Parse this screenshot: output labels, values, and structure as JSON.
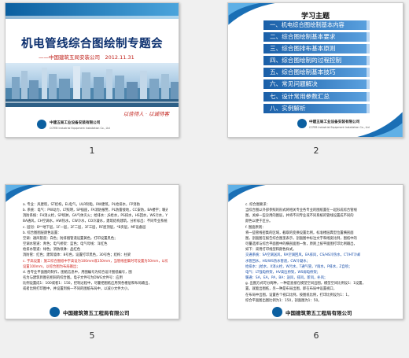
{
  "slides": [
    {
      "number": "1",
      "title": "机电管线综合图绘制专题会",
      "subtitle": "——中国建筑五局安装公司　2012.11.31",
      "slogan": "以信待人 · 以诚待客",
      "company_cn": "中建五局工业设备安装有限公司",
      "company_en": "CCFEB Industrial Equipment Installation Co., Ltd"
    },
    {
      "number": "2",
      "heading": "学习主题",
      "items": [
        "一、机电综合图绘制基本内容",
        "二、综合图绘制基本要求",
        "三、综合图排布基本原则",
        "四、综合图绘制的过程控制",
        "五、综合图绘制基本技巧",
        "六、常见问题解决",
        "七、设计常用参数汇总",
        "八、实例解析"
      ],
      "company_cn": "中建五局工业设备安装有限公司",
      "company_en": "CCFEB Industrial Equipment Installation Co., Ltd"
    },
    {
      "number": "5",
      "lines": [
        "a. 专业：风建筑，ST结构，EL电气，ULR制电，RW建筑，PL给排水，FP消防",
        "b. 系统：电气：PW动力，LT照明，SP插座，FA消防报警，PL防雷接地，CC安防，BA楼宇；暖通：SA送风，RA回风，EA排风，",
        "   消防系统：FH消火栓，SP喷淋，GA气体灭火；给排水：JS给水，PS排水，HS回水，WS污水，YS雨水；",
        "   BA通风，CH空调水，HW热水，CW冷水，CO冷凝水，建筑结构建筑，分析标出：不同专业系统，",
        "c. 层别：B**地下层，1F一层，2F二层，3F三层，RF屋顶层，*B夹层，MF设备层",
        "b. 综合图图层颜色设置：",
        "   空调：通风管道：白色；防排烟管道设置黄色，打印设置黑色；",
        "   空调水管道：青色；电气桥架：蓝色；电气母线：洋红色",
        "   给排水管道：绿色；消防喷淋：品红色",
        "   消防管：红色；建筑墙体：8号色，设置打印黑色，30号色；结构：柱梁",
        "c. 字高设置：施工综合图纸中字高设为100mm或150mm，当管线密集时可设置为50mm，以综合图为布局输出",
        "   设置100mm，以综合图为布局输出；",
        "d. 各专业平面图的制作，图纸信息中，用图编号为综合设计图纸编号，图",
        "   名为与建筑目图名相同的综合图。电子文件号为DWG文件号：应用",
        "   比例设置成1：100或者1：150，控制过程中，尽量把图纸应用到各楼层和布局输出，",
        "   或者比例打印图中，并设置到统一不同的图纸布局中，以减小文件大小。"
      ],
      "company_cn": "中国建筑第五工程局有限公司"
    },
    {
      "number": "6",
      "lines": [
        "c. 综合图要求：",
        "   当综合图以外部参照的形式将相关专业各专业的图纸置在一起形成综合管线",
        "   图，关掉一些没用的图层，并将不同专业或不同系统的管线设置成不同的",
        "   颜色以便于区分。",
        "f. 图面原则：",
        "   将一些管线密集的区域，截取的变换设置比例，标准楼层典型位置横剖面",
        "   图，剖面图在报告综合图里表示，剖面图中标注文字和线宽比例，图纸中的",
        "   尽量选择与综合平面图中的横剖面图一致，原则上按平面图打印比例输出，",
        "   如下：采用打印线型和颜色样式。",
        "   交通系统：SA空调送风，RA空调回风，EA排风，CS/HS冷热水，CT/HT冷却",
        "   水管回水，HS/WS热水管道，CW冷凝水；",
        "   给排水：J给水，X消火栓，W污水，T通气管，Y雨水，P排水，Z自喷；",
        "   电气：LT强电桥架，HV高压桥架，WS弱电桥架；",
        "   暖通：SA，EA，PA，BA：送风，排风，新风，补风；",
        "g. 出图方式可分两种，一种是直接在模型空间出图，模型空间比例设1：1设置，",
        "   置，就能出图纸，另一种是布局出图，即在布局中设置视口，",
        "   在布局中出图，设置各个视口比例，按图纸比例，打印比例设为1：1，",
        "   综合平面图出图比例为1：150，剖面图为1：50。"
      ],
      "company_cn": "中国建筑第五工程局有限公司"
    }
  ]
}
